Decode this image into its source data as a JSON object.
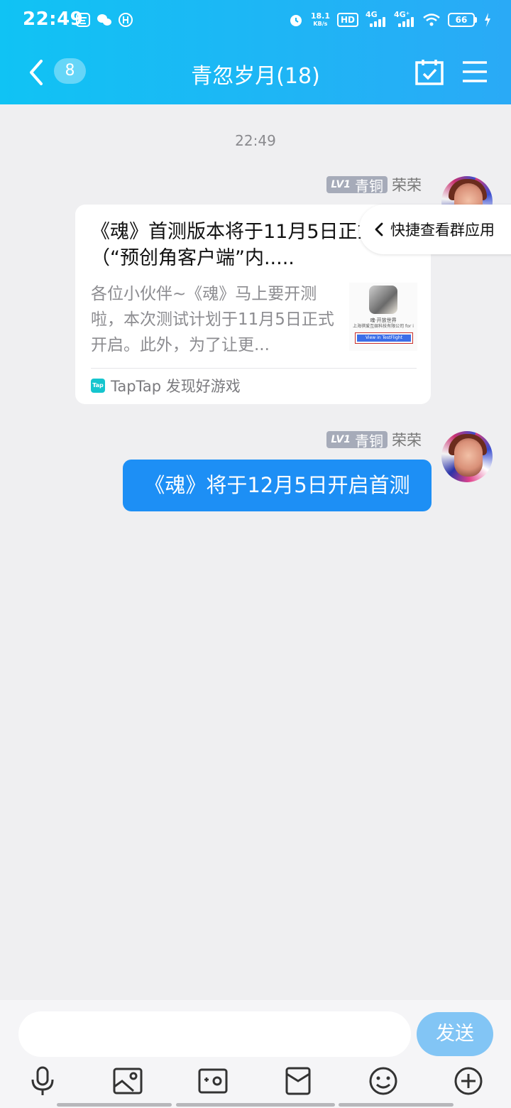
{
  "status_bar": {
    "time": "22:49",
    "net_speed": "18.1",
    "net_unit": "KB/s",
    "hd_label": "HD",
    "signal1_label": "4G",
    "signal2_label": "4G⁺",
    "battery": "66",
    "left_icons": [
      "app-icon",
      "wechat-icon",
      "accessibility-icon"
    ]
  },
  "nav": {
    "unread_count": "8",
    "title": "青忽岁月(18)"
  },
  "chat": {
    "timestamp": "22:49",
    "messages": [
      {
        "sender_level": "LV1",
        "sender_rank": "青铜",
        "sender_name": "荣荣",
        "type": "link_card",
        "title": "《魂》首测版本将于11月5日正式开启（“预创角客户端”内.....",
        "description": "各位小伙伴~《魂》马上要开测啦，本次测试计划于11月5日正式开启。此外，为了让更...",
        "thumb_line1": "魂·开放世界",
        "thumb_line2": "上海祺爱互娱科技有限公司 for i",
        "thumb_button": "View in TestFlight",
        "source_icon": "Tap",
        "source": "TapTap 发现好游戏"
      },
      {
        "sender_level": "LV1",
        "sender_rank": "青铜",
        "sender_name": "荣荣",
        "type": "text",
        "text": "《魂》将于12月5日开启首测"
      }
    ]
  },
  "quick_access": {
    "label": "快捷查看群应用"
  },
  "input": {
    "placeholder": "",
    "send_label": "发送",
    "tools": [
      "microphone-icon",
      "image-icon",
      "camera-icon",
      "red-packet-icon",
      "emoji-icon",
      "plus-icon"
    ]
  },
  "colors": {
    "header_start": "#10c3f4",
    "header_end": "#2aaaf6",
    "bubble": "#1d8ff5",
    "send_button": "#82c5f5",
    "background": "#efeff1"
  }
}
